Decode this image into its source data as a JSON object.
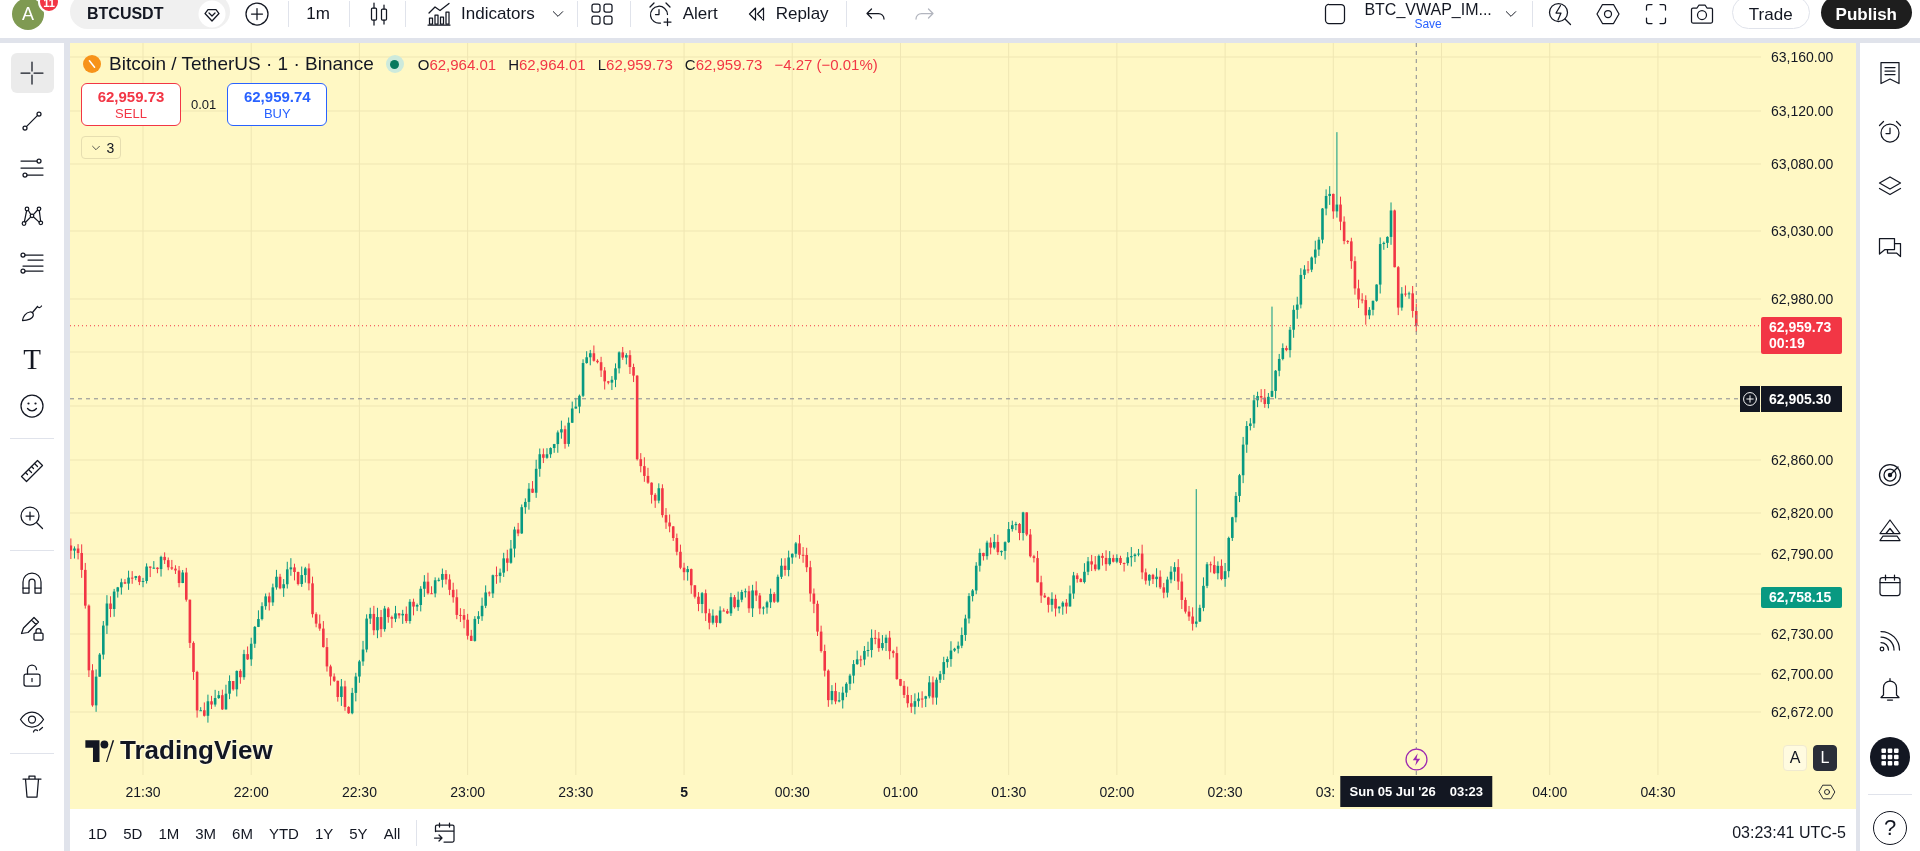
{
  "top_toolbar": {
    "avatar": {
      "initial": "A",
      "badge": "11"
    },
    "symbol": "BTCUSDT",
    "interval": "1m",
    "indicators": "Indicators",
    "alert": "Alert",
    "replay": "Replay",
    "undo": {
      "disabled": false
    },
    "redo": {
      "disabled": true
    },
    "layout": {
      "name": "BTC_VWAP_IM...",
      "save": "Save"
    },
    "trade": "Trade",
    "publish": "Publish"
  },
  "left_toolbar": {
    "groups": [
      {
        "tools": [
          {
            "selected": true
          },
          {
            "selected": false
          },
          {
            "selected": false
          },
          {
            "selected": false
          },
          {
            "selected": false
          },
          {
            "selected": false
          },
          {
            "selected": false,
            "glyph": "T"
          },
          {
            "selected": false
          }
        ]
      },
      {
        "tools": [
          {
            "selected": false
          },
          {
            "selected": false
          }
        ]
      },
      {
        "tools": [
          {
            "selected": false
          },
          {
            "selected": false
          },
          {
            "selected": false
          },
          {
            "selected": false
          }
        ]
      },
      {
        "tools": [
          {
            "selected": false
          }
        ]
      }
    ]
  },
  "legend": {
    "title": "Bitcoin / TetherUS · 1 · Binance",
    "market_open": true,
    "falling": true,
    "ohlc": [
      {
        "label": "O",
        "value": "62,964.01"
      },
      {
        "label": "H",
        "value": "62,964.01"
      },
      {
        "label": "L",
        "value": "62,959.73"
      },
      {
        "label": "C",
        "value": "62,959.73"
      }
    ],
    "change": "−4.27 (−0.01%)"
  },
  "order_panel": {
    "sell": {
      "price": "62,959.73",
      "label": "SELL"
    },
    "spread": "0.01",
    "buy": {
      "price": "62,959.74",
      "label": "BUY"
    }
  },
  "indicator_toggle": {
    "count": "3",
    "expanded": false
  },
  "chart": {
    "price_axis": [
      "63,160.00",
      "63,120.00",
      "63,080.00",
      "63,030.00",
      "62,980.00",
      "62,860.00",
      "62,820.00",
      "62,790.00",
      "62,730.00",
      "62,700.00",
      "62,672.00"
    ],
    "price_labels": [
      {
        "kind": "last",
        "price": "62,959.73",
        "countdown": "00:19"
      },
      {
        "kind": "crosshair",
        "price": "62,905.30"
      },
      {
        "kind": "marker",
        "price": "62,758.15"
      }
    ],
    "time_axis": [
      {
        "text": "21:30",
        "kind": "time"
      },
      {
        "text": "22:00",
        "kind": "time"
      },
      {
        "text": "22:30",
        "kind": "time"
      },
      {
        "text": "23:00",
        "kind": "time"
      },
      {
        "text": "23:30",
        "kind": "time"
      },
      {
        "text": "5",
        "kind": "day"
      },
      {
        "text": "00:30",
        "kind": "time"
      },
      {
        "text": "01:00",
        "kind": "time"
      },
      {
        "text": "01:30",
        "kind": "time"
      },
      {
        "text": "02:00",
        "kind": "time"
      },
      {
        "text": "02:30",
        "kind": "time"
      },
      {
        "text": "03:",
        "kind": "time"
      },
      {
        "text": "04:00",
        "kind": "time"
      },
      {
        "text": "04:30",
        "kind": "time"
      }
    ],
    "crosshair_time": {
      "date": "Sun 05 Jul '26",
      "time": "03:23"
    },
    "scale_modes": [
      {
        "label": "A",
        "selected": false
      },
      {
        "label": "L",
        "selected": true
      }
    ],
    "logo": "TradingView"
  },
  "bottom_toolbar": {
    "ranges": [
      "1D",
      "5D",
      "1M",
      "3M",
      "6M",
      "YTD",
      "1Y",
      "5Y",
      "All"
    ],
    "clock": "03:23:41 UTC-5"
  },
  "right_toolbar": {
    "help": "?"
  }
}
